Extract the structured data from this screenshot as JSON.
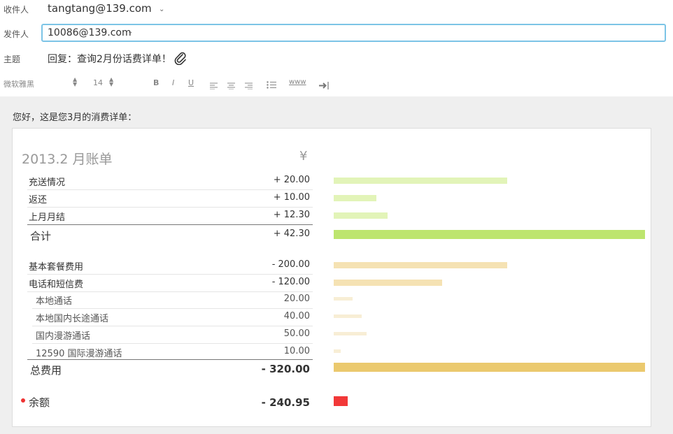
{
  "compose": {
    "to_label": "收件人",
    "to_value": "tangtang@139.com",
    "from_label": "发件人",
    "from_value": "10086@139.com",
    "subject_label": "主题",
    "subject_value": "回复：查询2月份话费详单！"
  },
  "toolbar": {
    "font_name": "微软雅黑",
    "font_size": "14",
    "bold": "B",
    "italic": "I",
    "underline": "U",
    "link": "www"
  },
  "body": {
    "greeting": "您好，这是您3月的消费详单：",
    "bill_title": "2013.2 月账单",
    "currency": "¥"
  },
  "colors": {
    "income_light": "#e2f4b8",
    "income_total": "#bde56e",
    "expense_main": "#f5e2b3",
    "expense_sub": "#f8eed5",
    "expense_total": "#ebc96e",
    "balance": "#f23838"
  },
  "bill": {
    "income": [
      {
        "label": "充送情况",
        "value": "+ 20.00",
        "amount": 20.0
      },
      {
        "label": "返还",
        "value": "+ 10.00",
        "amount": 10.0
      },
      {
        "label": "上月月结",
        "value": "+ 12.30",
        "amount": 12.3
      }
    ],
    "income_total": {
      "label": "合计",
      "value": "+ 42.30",
      "amount": 42.3
    },
    "expense": [
      {
        "label": "基本套餐费用",
        "value": "- 200.00",
        "amount": 200.0,
        "level": "main"
      },
      {
        "label": "电话和短信费",
        "value": "- 120.00",
        "amount": 120.0,
        "level": "main"
      },
      {
        "label": "本地通话",
        "value": "20.00",
        "amount": 20.0,
        "level": "sub"
      },
      {
        "label": "本地国内长途通话",
        "value": "40.00",
        "amount": 40.0,
        "level": "sub"
      },
      {
        "label": "国内漫游通话",
        "value": "50.00",
        "amount": 50.0,
        "level": "sub"
      },
      {
        "label": "12590 国际漫游通话",
        "value": "10.00",
        "amount": 10.0,
        "level": "sub"
      }
    ],
    "expense_total": {
      "label": "总费用",
      "value": "- 320.00",
      "amount": 320.0
    },
    "balance": {
      "label": "余额",
      "value": "- 240.95",
      "amount": 240.95
    }
  }
}
